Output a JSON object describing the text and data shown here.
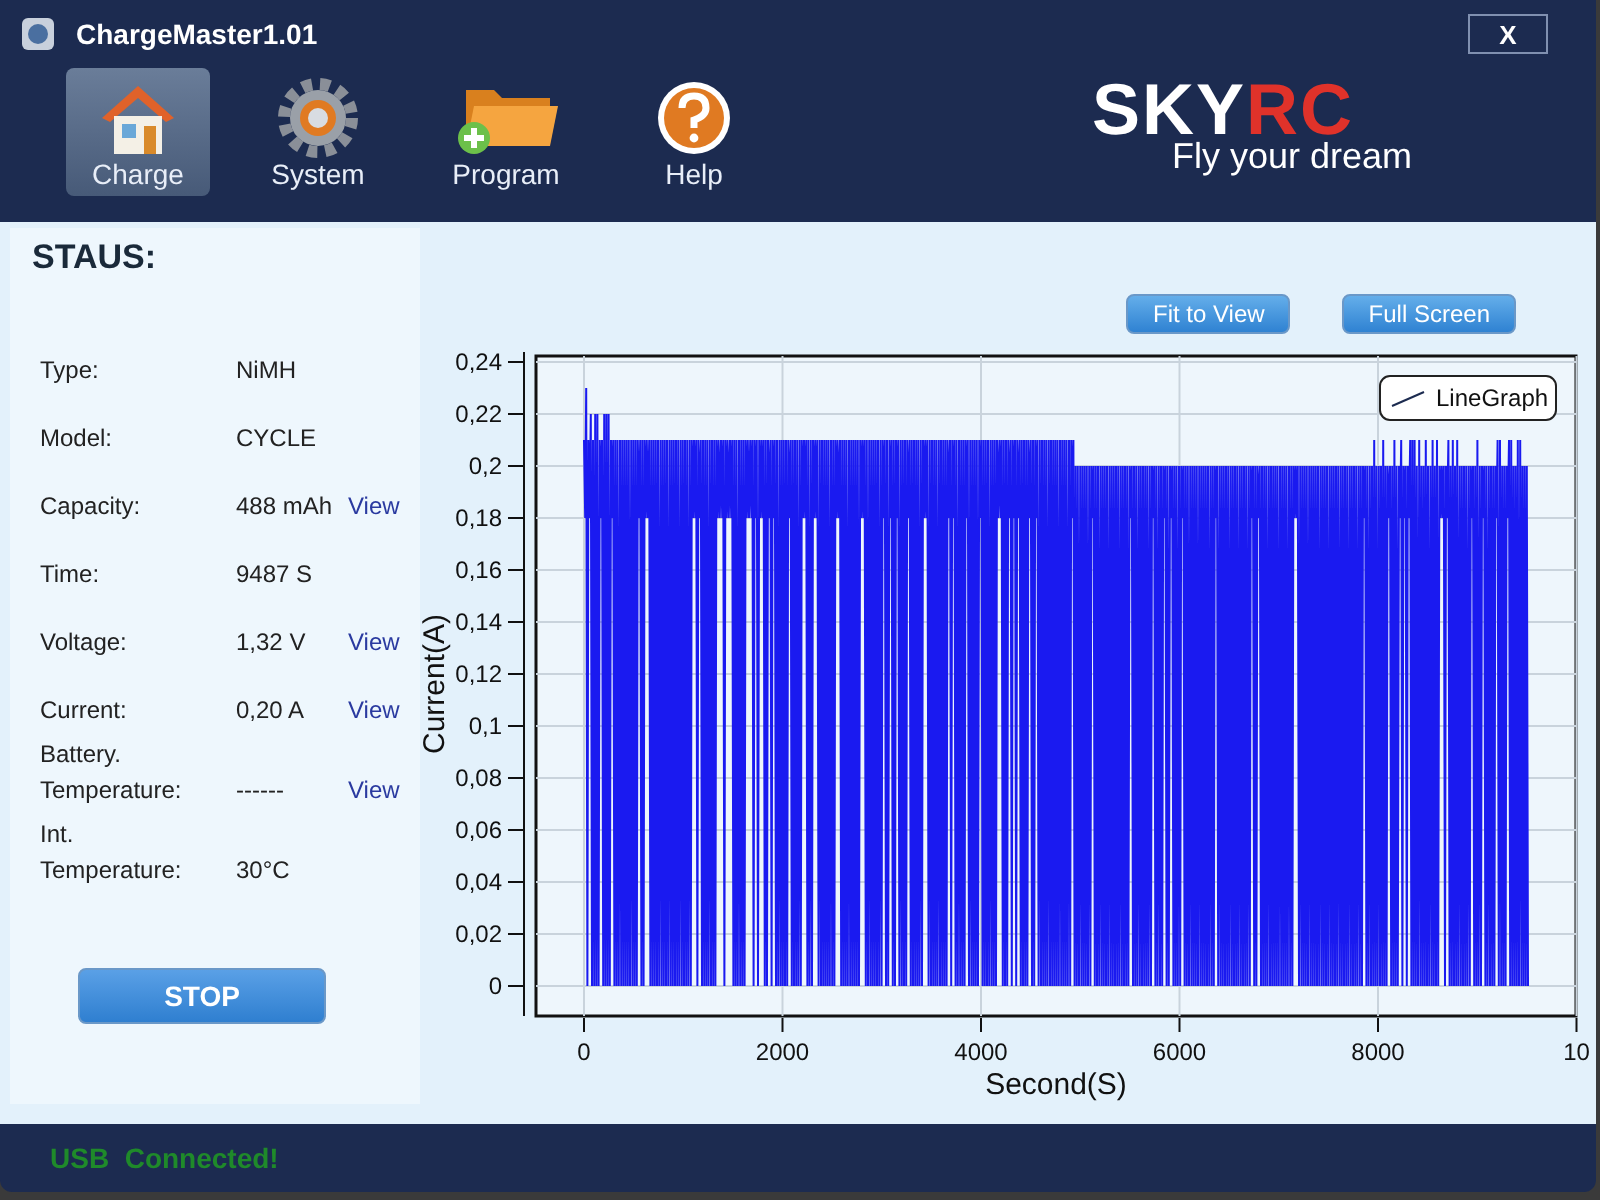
{
  "window": {
    "title": "ChargeMaster1.01",
    "close": "X"
  },
  "toolbar": [
    {
      "label": "Charge",
      "kind": "house",
      "selected": true
    },
    {
      "label": "System",
      "kind": "gear",
      "selected": false
    },
    {
      "label": "Program",
      "kind": "folder",
      "selected": false
    },
    {
      "label": "Help",
      "kind": "help",
      "selected": false
    }
  ],
  "logo": {
    "part_1": "SKY",
    "part_2": "RC",
    "slogan": "Fly your dream"
  },
  "status": {
    "heading": "STAUS:",
    "rows": [
      {
        "label": "Type:",
        "value": "NiMH"
      },
      {
        "label": "Model:",
        "value": "CYCLE"
      },
      {
        "label": "Capacity:",
        "value": "488 mAh",
        "link": "View"
      },
      {
        "label": "Time:",
        "value": "9487 S"
      },
      {
        "label": "Voltage:",
        "value": "1,32 V",
        "link": "View"
      },
      {
        "label": "Current:",
        "value": "0,20 A",
        "link": "View"
      },
      {
        "label": "Battery.\nTemperature:",
        "value": "------",
        "link": "View"
      },
      {
        "label": "Int.\nTemperature:",
        "value": "30°C"
      }
    ],
    "button": "STOP"
  },
  "chart": {
    "buttons": [
      "Fit to View",
      "Full Screen"
    ],
    "legend": "LineGraph",
    "ylabel": "Current(A)",
    "xlabel": "Second(S)",
    "yticks": [
      "0,24",
      "0,22",
      "0,2",
      "0,18",
      "0,16",
      "0,14",
      "0,12",
      "0,1",
      "0,08",
      "0,06",
      "0,04",
      "0,02",
      "0"
    ],
    "xticks": [
      "0",
      "2000",
      "4000",
      "6000",
      "8000",
      "10"
    ]
  },
  "status_bar": "USB  Connected!"
}
